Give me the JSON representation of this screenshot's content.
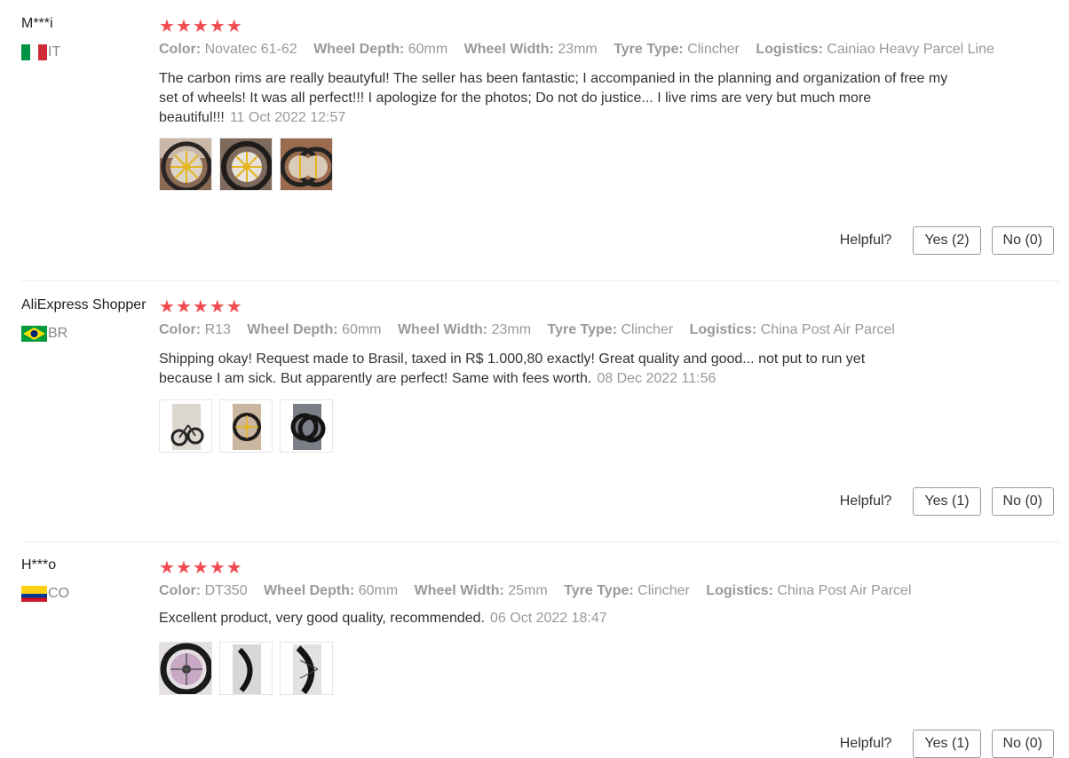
{
  "reviews": [
    {
      "name": "M***i",
      "country": "IT",
      "flag": "italy",
      "stars": 5,
      "attrs": [
        {
          "key": "Color:",
          "val": "Novatec 61-62"
        },
        {
          "key": "Wheel Depth:",
          "val": "60mm"
        },
        {
          "key": "Wheel Width:",
          "val": "23mm"
        },
        {
          "key": "Tyre Type:",
          "val": "Clincher"
        },
        {
          "key": "Logistics:",
          "val": "Cainiao Heavy Parcel Line"
        }
      ],
      "text": "The carbon rims are really beautyful! The seller has been fantastic; I accompanied in the planning and organization of free my set of wheels! It was all perfect!!! I apologize for the photos; Do not do justice... I live rims are very but much more beautiful!!!",
      "date": "11 Oct 2022 12:57",
      "photos": [
        "wheel-photo-1",
        "wheel-photo-2",
        "wheel-photo-3"
      ],
      "helpful_label": "Helpful?",
      "yes": "Yes (2)",
      "no": "No (0)"
    },
    {
      "name": "AliExpress Shopper",
      "country": "BR",
      "flag": "brazil",
      "stars": 5,
      "attrs": [
        {
          "key": "Color:",
          "val": "R13"
        },
        {
          "key": "Wheel Depth:",
          "val": "60mm"
        },
        {
          "key": "Wheel Width:",
          "val": "23mm"
        },
        {
          "key": "Tyre Type:",
          "val": "Clincher"
        },
        {
          "key": "Logistics:",
          "val": "China Post Air Parcel"
        }
      ],
      "text": "Shipping okay! Request made to Brasil, taxed in R$ 1.000,80 exactly! Great quality and good... not put to run yet because I am sick. But apparently are perfect! Same with fees worth.",
      "date": "08 Dec 2022 11:56",
      "photos": [
        "bike-photo",
        "wheel-photo",
        "wheels-pair-photo"
      ],
      "helpful_label": "Helpful?",
      "yes": "Yes (1)",
      "no": "No (0)"
    },
    {
      "name": "H***o",
      "country": "CO",
      "flag": "colombia",
      "stars": 5,
      "attrs": [
        {
          "key": "Color:",
          "val": "DT350"
        },
        {
          "key": "Wheel Depth:",
          "val": "60mm"
        },
        {
          "key": "Wheel Width:",
          "val": "25mm"
        },
        {
          "key": "Tyre Type:",
          "val": "Clincher"
        },
        {
          "key": "Logistics:",
          "val": "China Post Air Parcel"
        }
      ],
      "text": "Excellent product, very good quality, recommended.",
      "date": "06 Oct 2022 18:47",
      "photos": [
        "hub-photo",
        "rim-photo",
        "spokes-photo"
      ],
      "helpful_label": "Helpful?",
      "yes": "Yes (1)",
      "no": "No (0)"
    }
  ],
  "colors": {
    "star": "#f14b51",
    "muted": "#999999",
    "text": "#333333"
  }
}
